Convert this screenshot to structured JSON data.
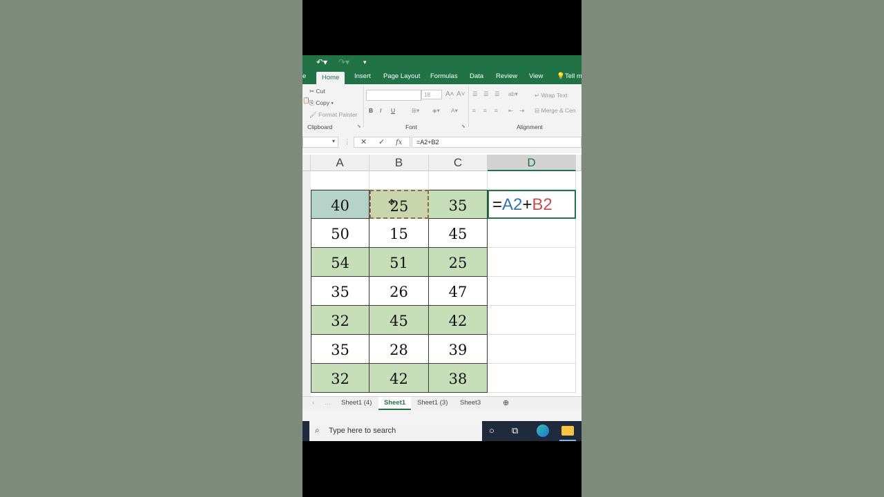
{
  "ribbon": {
    "tabs": [
      "Home",
      "Insert",
      "Page Layout",
      "Formulas",
      "Data",
      "Review",
      "View",
      "Tell m"
    ],
    "active_tab": "Home",
    "clipboard": {
      "cut": "Cut",
      "copy": "Copy",
      "format_painter": "Format Painter",
      "label": "Clipboard"
    },
    "font": {
      "size": "18",
      "label": "Font",
      "bold": "B",
      "italic": "I",
      "underline": "U"
    },
    "alignment": {
      "wrap_text": "Wrap Text",
      "merge": "Merge & Cen",
      "label": "Alignment"
    }
  },
  "formula_bar": {
    "value": "=A2+B2",
    "cancel": "✕",
    "enter": "✓",
    "fx": "fx"
  },
  "columns": [
    "A",
    "B",
    "C",
    "D"
  ],
  "rows": [
    [
      "40",
      "25",
      "35"
    ],
    [
      "50",
      "15",
      "45"
    ],
    [
      "54",
      "51",
      "25"
    ],
    [
      "35",
      "26",
      "47"
    ],
    [
      "32",
      "45",
      "42"
    ],
    [
      "35",
      "28",
      "39"
    ],
    [
      "32",
      "42",
      "38"
    ]
  ],
  "active_cell": {
    "eq": "=",
    "ref1": "A2",
    "plus": "+",
    "ref2": "B2"
  },
  "sheet_tabs": [
    "Sheet1 (4)",
    "Sheet1",
    "Sheet1 (3)",
    "Sheet3"
  ],
  "active_sheet": "Sheet1",
  "taskbar": {
    "search_placeholder": "Type here to search"
  },
  "colors": {
    "excel_green": "#217346",
    "cell_green": "#c7dfb8",
    "ref_blue": "#2f75b5",
    "ref_red": "#c0504d"
  }
}
